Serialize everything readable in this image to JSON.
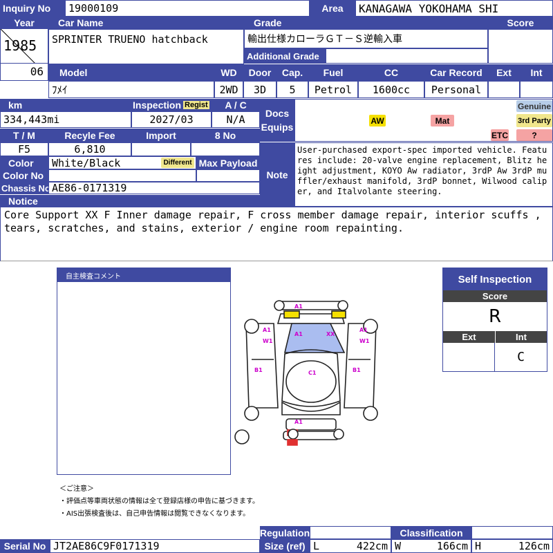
{
  "header": {
    "inquiry_label": "Inquiry No",
    "inquiry_value": "19000109",
    "area_label": "Area",
    "area_value": "KANAGAWA YOKOHAMA SHI",
    "year_label": "Year",
    "carname_label": "Car Name",
    "grade_label": "Grade",
    "score_label": "Score",
    "year_value": "1985",
    "month_value": "06",
    "carname_value": "SPRINTER TRUENO hatchback",
    "grade_value": "輸出仕様カローラＧＴ－Ｓ逆輸入車",
    "additional_grade_label": "Additional Grade",
    "model_label": "Model",
    "wd_label": "WD",
    "door_label": "Door",
    "cap_label": "Cap.",
    "fuel_label": "Fuel",
    "cc_label": "CC",
    "carrecord_label": "Car Record",
    "ext_label": "Ext",
    "int_label": "Int",
    "model_value": "ﾌﾒｲ",
    "wd_value": "2WD",
    "door_value": "3D",
    "cap_value": "5",
    "fuel_value": "Petrol",
    "cc_value": "1600cc",
    "carrecord_value": "Personal"
  },
  "mid": {
    "km_label": "km",
    "inspection_label": "Inspection",
    "regist_badge": "Regist",
    "ac_label": "A / C",
    "docs_label": "Docs Equips",
    "km_value": "334,443mi",
    "inspection_value": "2027/03",
    "ac_value": "N/A",
    "tm_label": "T / M",
    "recycle_label": "Recyle Fee",
    "import_label": "Import",
    "eightno_label": "8 No",
    "tm_value": "F5",
    "recycle_value": "6,810",
    "color_label": "Color",
    "color_value": "White/Black",
    "different_badge": "Different",
    "maxpayload_label": "Max Payload",
    "colorno_label": "Color No",
    "chassis_label": "Chassis No",
    "chassis_value": "AE86-0171319",
    "note_label": "Note",
    "note_value": "User-purchased export-spec imported vehicle. Features include: 20-valve engine replacement, Blitz height adjustment, KOYO Aw radiator, 3rdP Aw 3rdP muffler/exhaust manifold, 3rdP bonnet, Wilwood caliper, and Italvolante steering.",
    "genuine_badge": "Genuine",
    "aw_badge": "AW",
    "mat_badge": "Mat",
    "thirdparty_badge": "3rd Party",
    "etc_badge": "ETC",
    "question_badge": "?"
  },
  "notice": {
    "label": "Notice",
    "text": "Core Support XX F Inner damage repair, F cross member damage repair, interior scuffs , tears, scratches, and stains, exterior / engine room repainting."
  },
  "sheet": {
    "comment_title": "自主検査コメント",
    "caution_title": "＜ご注意＞",
    "caution_1": "・評価点等車両状態の情報は全て登録店様の申告に基づきます。",
    "caution_2": "・AIS出張検査後は、自己申告情報は閲覧できなくなります。",
    "marks": {
      "front_a1": "A1",
      "front_xx": "XX",
      "front_right_a1": "A1",
      "left_a1": "A1",
      "left_w1": "W1",
      "right_a1": "A1",
      "right_w1": "W1",
      "left_b1": "B1",
      "right_b1": "B1",
      "roof_c1": "C1",
      "rear_a1": "A1"
    }
  },
  "self_inspection": {
    "title": "Self Inspection",
    "score_label": "Score",
    "score_value": "R",
    "ext_label": "Ext",
    "int_label": "Int",
    "ext_value": "",
    "int_value": "C"
  },
  "footer": {
    "serial_label": "Serial No",
    "serial_value": "JT2AE86C9F0171319",
    "regulation_label": "Regulation",
    "size_label": "Size (ref)",
    "classification_label": "Classification",
    "l_label": "L",
    "l_value": "422cm",
    "w_label": "W",
    "w_value": "166cm",
    "h_label": "H",
    "h_value": "126cm"
  },
  "colors": {
    "header_blue": "#3f4aa1",
    "badge_yellow": "#f0e68c",
    "aw_yellow": "#f5e000",
    "mat_red": "#f5a3a3",
    "genuine_blue": "#b7cde8",
    "damage_pink": "#cc00cc",
    "highlight_blue": "#aabdf0",
    "highlight_yellow": "#f5e000",
    "highlight_red": "#e03030"
  }
}
